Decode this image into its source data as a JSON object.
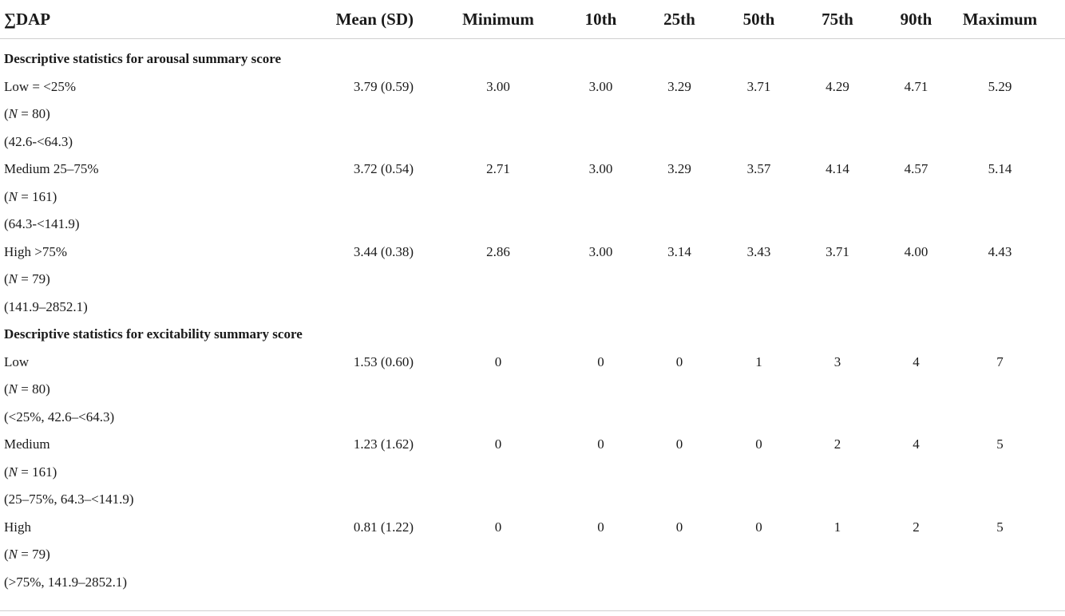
{
  "header": {
    "col0": "∑DAP",
    "col1": "Mean (SD)",
    "col2": "Minimum",
    "col3": "10th",
    "col4": "25th",
    "col5": "50th",
    "col6": "75th",
    "col7": "90th",
    "col8": "Maximum"
  },
  "sections": [
    {
      "title": "Descriptive statistics for arousal summary score",
      "groups": [
        {
          "label": "Low = <25%",
          "n_prefix": "(",
          "n_var": "N",
          "n_suffix": " = 80)",
          "range": "(42.6-<64.3)",
          "mean": "3.79 (0.59)",
          "min": "3.00",
          "p10": "3.00",
          "p25": "3.29",
          "p50": "3.71",
          "p75": "4.29",
          "p90": "4.71",
          "max": "5.29"
        },
        {
          "label": "Medium 25–75%",
          "n_prefix": "(",
          "n_var": "N",
          "n_suffix": " = 161)",
          "range": "(64.3-<141.9)",
          "mean": "3.72 (0.54)",
          "min": "2.71",
          "p10": "3.00",
          "p25": "3.29",
          "p50": "3.57",
          "p75": "4.14",
          "p90": "4.57",
          "max": "5.14"
        },
        {
          "label": "High >75%",
          "n_prefix": "(",
          "n_var": "N",
          "n_suffix": " = 79)",
          "range": "(141.9–2852.1)",
          "mean": "3.44 (0.38)",
          "min": "2.86",
          "p10": "3.00",
          "p25": "3.14",
          "p50": "3.43",
          "p75": "3.71",
          "p90": "4.00",
          "max": "4.43"
        }
      ]
    },
    {
      "title": "Descriptive statistics for excitability summary score",
      "groups": [
        {
          "label": "Low",
          "n_prefix": "(",
          "n_var": "N",
          "n_suffix": " = 80)",
          "range": "(<25%, 42.6–<64.3)",
          "mean": "1.53 (0.60)",
          "min": "0",
          "p10": "0",
          "p25": "0",
          "p50": "1",
          "p75": "3",
          "p90": "4",
          "max": "7"
        },
        {
          "label": "Medium",
          "n_prefix": "(",
          "n_var": "N",
          "n_suffix": " = 161)",
          "range": "(25–75%, 64.3–<141.9)",
          "mean": "1.23 (1.62)",
          "min": "0",
          "p10": "0",
          "p25": "0",
          "p50": "0",
          "p75": "2",
          "p90": "4",
          "max": "5"
        },
        {
          "label": "High",
          "n_prefix": "(",
          "n_var": "N",
          "n_suffix": " = 79)",
          "range": "(>75%, 141.9–2852.1)",
          "mean": "0.81 (1.22)",
          "min": "0",
          "p10": "0",
          "p25": "0",
          "p50": "0",
          "p75": "1",
          "p90": "2",
          "max": "5"
        }
      ]
    }
  ]
}
